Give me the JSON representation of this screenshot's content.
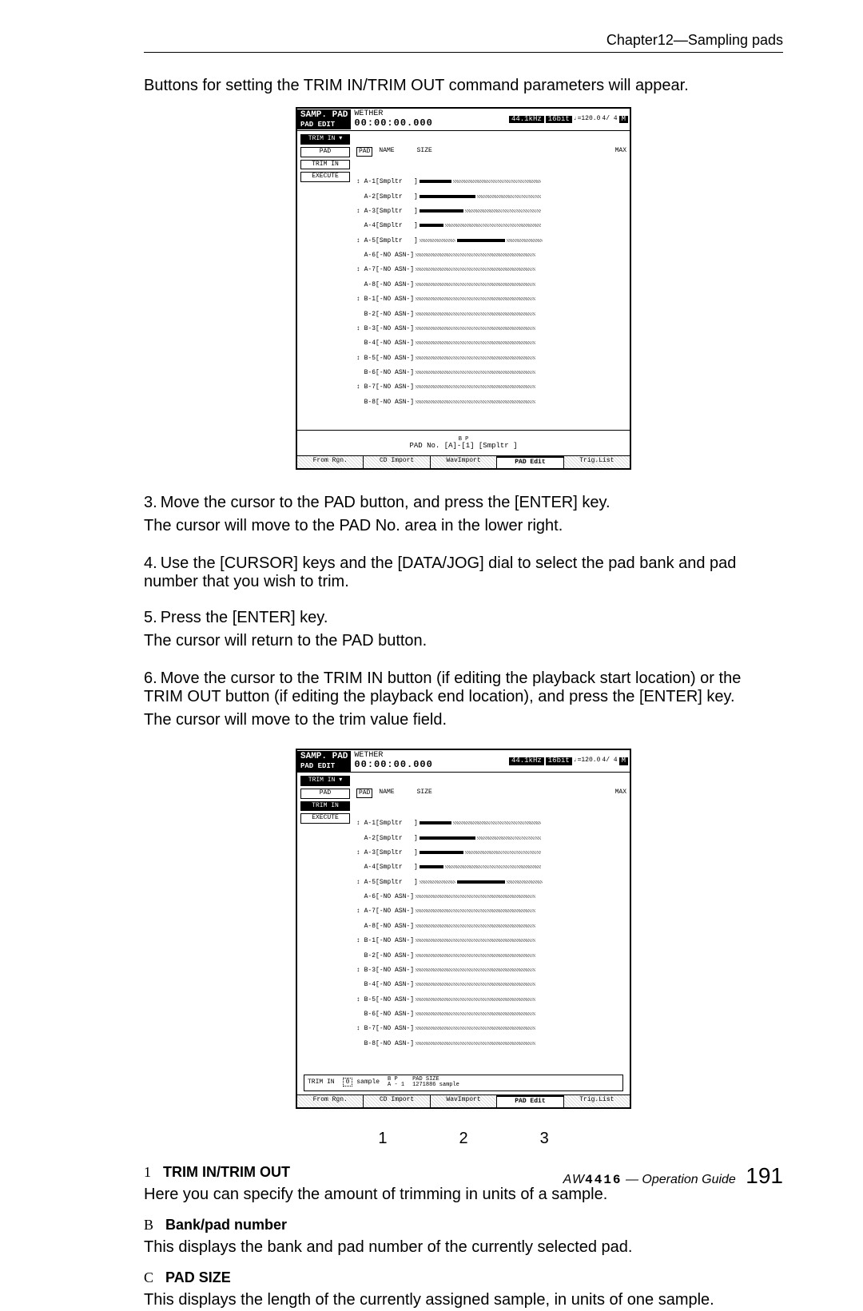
{
  "header": {
    "chapter": "Chapter12—Sampling pads"
  },
  "intro": "Buttons for setting the TRIM IN/TRIM OUT command parameters will appear.",
  "screenshot1": {
    "title_block1": "SAMP. PAD",
    "title_block2": "PAD EDIT",
    "song_name": "WETHER",
    "time": "00:00:00.000",
    "rate": "44.1kHz",
    "bits": "16bit",
    "tempo": "♩=120.0",
    "meter": "4/ 4",
    "m_icon": "M",
    "left_buttons": [
      "TRIM IN ▾",
      "PAD",
      "TRIM IN",
      "EXECUTE"
    ],
    "list_header": {
      "col1": "PAD",
      "col2": "NAME",
      "col3": "SIZE",
      "col4": "MAX"
    },
    "rows": [
      "A-1[Smpltr   ]",
      "A-2[Smpltr   ]",
      "A-3[Smpltr   ]",
      "A-4[Smpltr   ]",
      "A-5[Smpltr   ]",
      "A-6[-NO ASN-]",
      "A-7[-NO ASN-]",
      "A-8[-NO ASN-]",
      "B-1[-NO ASN-]",
      "B-2[-NO ASN-]",
      "B-3[-NO ASN-]",
      "B-4[-NO ASN-]",
      "B-5[-NO ASN-]",
      "B-6[-NO ASN-]",
      "B-7[-NO ASN-]",
      "B-8[-NO ASN-]"
    ],
    "bottom_line": "PAD No. [A]-[1]   [Smpltr  ]",
    "bottom_labels": {
      "b": "B",
      "p": "P"
    },
    "tabs": [
      "From Rgn.",
      "CD Import",
      "WavImport",
      "PAD Edit",
      "Trig.List"
    ]
  },
  "steps": [
    {
      "num": "3.",
      "head": "Move the cursor to the PAD button, and press the [ENTER] key.",
      "body": "The cursor will move to the PAD No. area in the lower right."
    },
    {
      "num": "4.",
      "head": "Use the [CURSOR] keys and the [DATA/JOG] dial to select the pad bank and pad number that you wish to trim.",
      "body": ""
    },
    {
      "num": "5.",
      "head": "Press the [ENTER] key.",
      "body": "The cursor will return to the PAD button."
    },
    {
      "num": "6.",
      "head": "Move the cursor to the TRIM IN button (if editing the playback start location) or the TRIM OUT button (if editing the playback end location), and press the [ENTER] key.",
      "body": "The cursor will move to the trim value field."
    }
  ],
  "screenshot2": {
    "trim_label": "TRIM IN",
    "trim_value": "0",
    "trim_unit": "sample",
    "bp_b": "B",
    "bp_p": "P",
    "bp_val": "A - 1",
    "pad_size_label": "PAD SIZE",
    "pad_size_value": "1271886 sample",
    "tabs": [
      "From Rgn.",
      "CD Import",
      "WavImport",
      "PAD Edit",
      "Trig.List"
    ],
    "callouts": [
      "1",
      "2",
      "3"
    ]
  },
  "sections": [
    {
      "num": "1",
      "marker": "①",
      "title": "TRIM IN/TRIM OUT",
      "desc": "Here you can specify the amount of trimming in units of a sample."
    },
    {
      "num": "B",
      "marker": "②",
      "title": "Bank/pad number",
      "desc": "This displays the bank and pad number of the currently selected pad."
    },
    {
      "num": "C",
      "marker": "③",
      "title": "PAD SIZE",
      "desc": "This displays the length of the currently assigned sample, in units of one sample."
    }
  ],
  "footer": {
    "logo": "AW",
    "model": "4416",
    "guide": "— Operation Guide",
    "page": "191"
  }
}
